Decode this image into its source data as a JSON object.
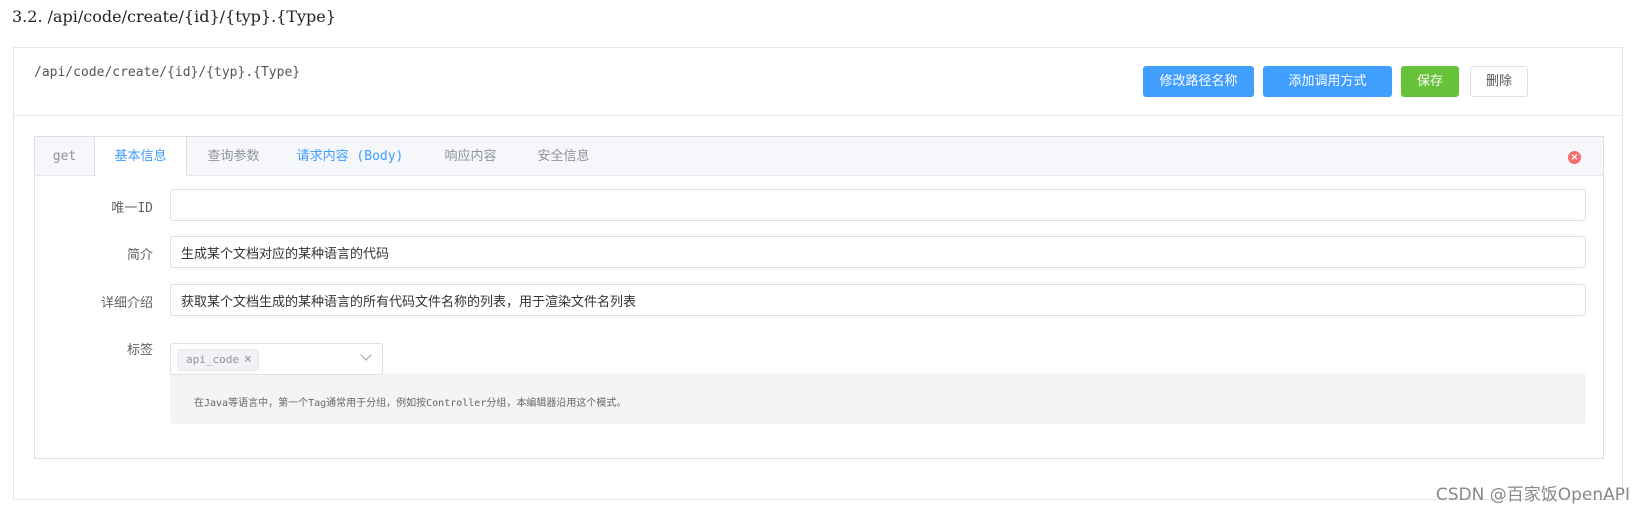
{
  "section": {
    "heading": "3.2.  /api/code/create/{id}/{typ}.{Type}"
  },
  "endpoint": {
    "path": "/api/code/create/{id}/{typ}.{Type}",
    "buttons": {
      "rename": "修改路径名称",
      "add_method": "添加调用方式",
      "save": "保存",
      "delete": "删除"
    }
  },
  "tabs": [
    {
      "label": "get"
    },
    {
      "label": "基本信息"
    },
    {
      "label": "查询参数"
    },
    {
      "label": "请求内容 (Body)"
    },
    {
      "label": "响应内容"
    },
    {
      "label": "安全信息"
    }
  ],
  "active_tab": "基本信息",
  "form": {
    "id": {
      "label": "唯一ID",
      "value": ""
    },
    "summary": {
      "label": "简介",
      "value": "生成某个文档对应的某种语言的代码"
    },
    "description": {
      "label": "详细介绍",
      "value": "获取某个文档生成的某种语言的所有代码文件名称的列表，用于渲染文件名列表"
    },
    "tags": {
      "label": "标签",
      "selected": [
        "api_code"
      ],
      "hint": "在Java等语言中，第一个Tag通常用于分组，例如按Controller分组，本编辑器沿用这个模式。"
    }
  },
  "icons": {
    "close_tab_panel": "close-circle-icon",
    "tag_remove": "close-icon",
    "dropdown": "chevron-down-icon"
  },
  "colors": {
    "primary": "#409eff",
    "success": "#67c23a",
    "danger": "#f56c6c"
  },
  "watermark": "CSDN @百家饭OpenAPI"
}
